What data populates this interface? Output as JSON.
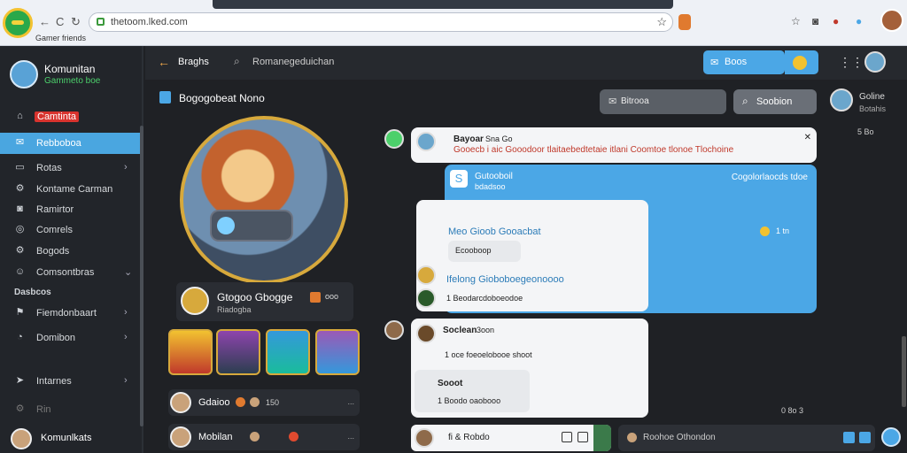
{
  "browser": {
    "caption": "Gamer friends",
    "url": "thetoom.lked.com",
    "nav_back": "←",
    "nav_reload": "C",
    "nav_forward": "↻",
    "star": "☆"
  },
  "sidebar": {
    "user_name": "Komunitan",
    "user_status": "Gammeto boe",
    "items": [
      {
        "label": "Camtinta",
        "icon": "home-icon"
      },
      {
        "label": "Rebboboa",
        "icon": "chat-icon"
      },
      {
        "label": "Rotas",
        "icon": "folder-icon"
      },
      {
        "label": "Kontame Carman",
        "icon": "gear-icon"
      },
      {
        "label": "Ramirtor",
        "icon": "camera-icon"
      },
      {
        "label": "Comrels",
        "icon": "users-icon"
      },
      {
        "label": "Bogods",
        "icon": "settings-icon"
      },
      {
        "label": "Comsontbras",
        "icon": "group-icon"
      }
    ],
    "section_label": "Dasbcos",
    "section_items": [
      {
        "label": "Fiemdonbaart",
        "icon": "flag-icon"
      },
      {
        "label": "Domibon",
        "icon": "clock-icon"
      },
      {
        "label": "Intarnes",
        "icon": "send-icon"
      },
      {
        "label": "Rin",
        "icon": "gear-icon"
      }
    ],
    "footer_name": "Komunlkats"
  },
  "header": {
    "back_label": "Braghs",
    "search_placeholder": "Romanegeduichan",
    "blue_button": "Boos"
  },
  "profile": {
    "title": "Bogogobeat Nono",
    "card_name": "Gtogoo Gbogge",
    "card_sub": "Riadogba",
    "card_badge": "ooo",
    "friends": [
      {
        "name": "Gdaioo",
        "meta": "150",
        "more": "..."
      },
      {
        "name": "Mobilan",
        "meta": "",
        "more": "..."
      }
    ]
  },
  "chat": {
    "pill1": "Bitrooa",
    "pill2": "Soobion",
    "right_name": "Goline",
    "right_sub": "Botahis",
    "right_time": "5 Bo",
    "msg1_name": "Bayoar",
    "msg1_time": "Sna Go",
    "msg1_text": "Gooecb i aic  Gooodoor tlaitaebedtetaie itlani  Coomtoe tlonoe Tlochoine",
    "msg2_title": "Gutooboil",
    "msg2_sub": "bdadsoo",
    "msg2_right": "Cogolorlaocds tdoe",
    "msg3_line": "Meo Gioob Gooacbat",
    "msg3_pill": "Ecooboop",
    "msg3_bold": "Ifelong Gioboboegeonoooo",
    "msg3_small": "1 Beodarcdoboeodoe",
    "msg2_right2": "1 tn",
    "msg4_name": "Soclean",
    "msg4_time": "3oon",
    "msg4_text": "1 oce foeoelobooe shoot",
    "msg5_title": "Sooot",
    "msg5_sub": "1 Boodo oaobooo",
    "time_bottom": "0 8o 3",
    "input1": "fi & Robdo",
    "input2": "Roohoe Othondon"
  }
}
